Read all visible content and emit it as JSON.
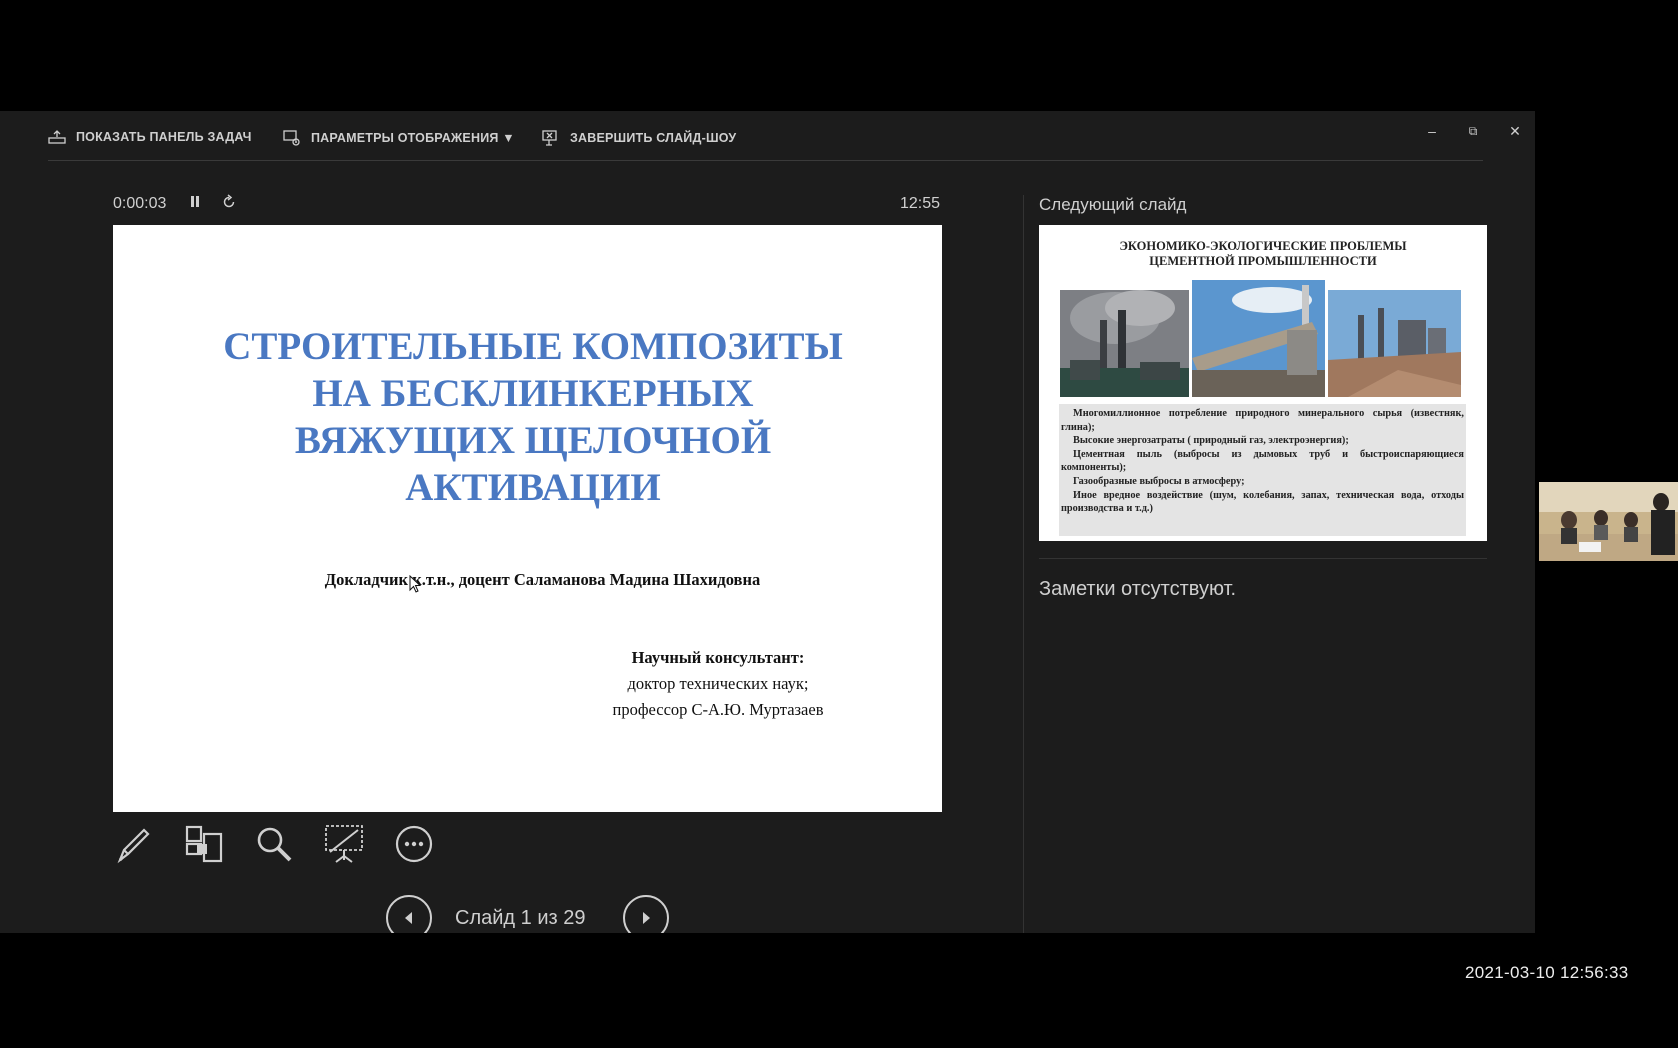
{
  "toolbar": {
    "show_taskbar": "ПОКАЗАТЬ ПАНЕЛЬ ЗАДАЧ",
    "display_settings": "ПАРАМЕТРЫ ОТОБРАЖЕНИЯ ▼",
    "end_show": "ЗАВЕРШИТЬ СЛАЙД-ШОУ"
  },
  "window": {
    "minimize": "–",
    "restore": "⧉",
    "close": "✕"
  },
  "status": {
    "elapsed": "0:00:03",
    "clock": "12:55"
  },
  "current_slide": {
    "title_lines": [
      "СТРОИТЕЛЬНЫЕ КОМПОЗИТЫ",
      "НА БЕСКЛИНКЕРНЫХ",
      "ВЯЖУЩИХ ЩЕЛОЧНОЙ",
      "АКТИВАЦИИ"
    ],
    "speaker": "Докладчик к.т.н., доцент Саламанова Мадина Шахидовна",
    "consultant_heading": "Научный консультант:",
    "consultant_line1": "доктор технических наук;",
    "consultant_line2": "профессор С-А.Ю. Муртазаев"
  },
  "navigation": {
    "slide_counter": "Слайд 1 из 29"
  },
  "next_slide": {
    "label": "Следующий слайд",
    "title_line1": "ЭКОНОМИКО-ЭКОЛОГИЧЕСКИЕ ПРОБЛЕМЫ",
    "title_line2": "ЦЕМЕНТНОЙ ПРОМЫШЛЕННОСТИ",
    "bullets": [
      "Многомиллионное потребление природного минерального сырья (известняк, глина);",
      "Высокие энергозатраты ( природный газ, электроэнергия);",
      "Цементная пыль (выбросы из дымовых труб и быстроиспаряющиеся компоненты);",
      "Газообразные выбросы в атмосферу;",
      "Иное вредное воздействие (шум, колебания, запах, техническая вода, отходы производства и т.д.)"
    ]
  },
  "notes": {
    "text": "Заметки отсутствуют."
  },
  "overlay": {
    "timestamp": "2021-03-10 12:56:33"
  },
  "colors": {
    "title_blue": "#4a78c2",
    "panel_bg": "#1c1c1c"
  }
}
